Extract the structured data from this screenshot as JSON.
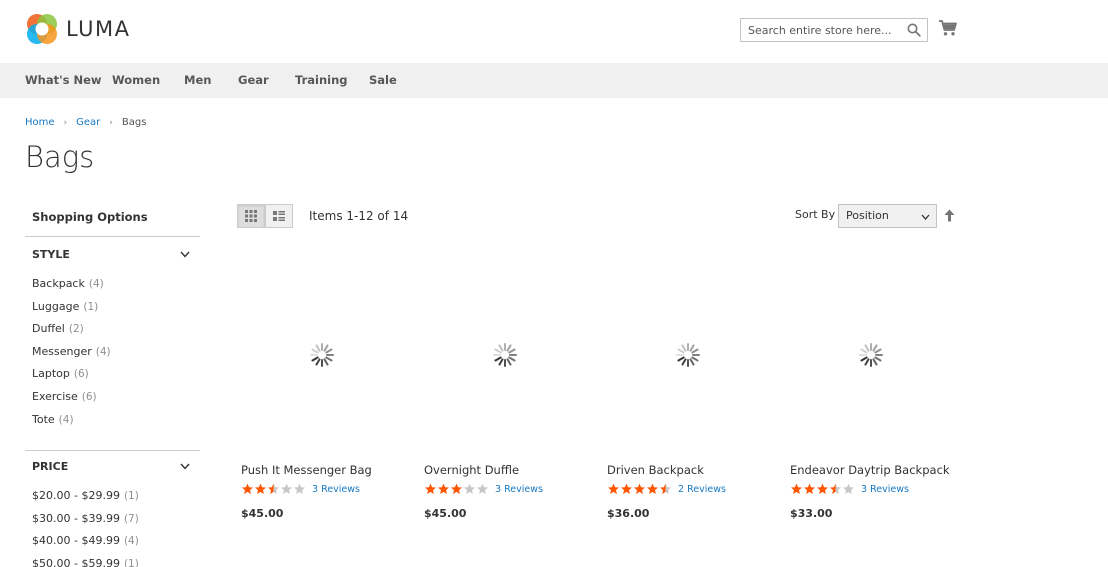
{
  "header": {
    "brand": "LUMA",
    "search_placeholder": "Search entire store here..."
  },
  "nav": [
    "What's New",
    "Women",
    "Men",
    "Gear",
    "Training",
    "Sale"
  ],
  "breadcrumbs": {
    "home": "Home",
    "gear": "Gear",
    "current": "Bags"
  },
  "page_title": "Bags",
  "sidebar": {
    "title": "Shopping Options",
    "filters": [
      {
        "name": "STYLE",
        "options": [
          {
            "label": "Backpack",
            "count": "(4)"
          },
          {
            "label": "Luggage",
            "count": "(1)"
          },
          {
            "label": "Duffel",
            "count": "(2)"
          },
          {
            "label": "Messenger",
            "count": "(4)"
          },
          {
            "label": "Laptop",
            "count": "(6)"
          },
          {
            "label": "Exercise",
            "count": "(6)"
          },
          {
            "label": "Tote",
            "count": "(4)"
          }
        ]
      },
      {
        "name": "PRICE",
        "options": [
          {
            "label": "$20.00 - $29.99",
            "count": "(1)"
          },
          {
            "label": "$30.00 - $39.99",
            "count": "(7)"
          },
          {
            "label": "$40.00 - $49.99",
            "count": "(4)"
          },
          {
            "label": "$50.00 - $59.99",
            "count": "(1)"
          }
        ]
      }
    ]
  },
  "toolbar": {
    "amount": "Items 1-12 of 14",
    "sort_label": "Sort By",
    "sort_value": "Position"
  },
  "products": [
    {
      "name": "Push It Messenger Bag",
      "rating": 2.5,
      "reviews": "3 Reviews",
      "price": "$45.00"
    },
    {
      "name": "Overnight Duffle",
      "rating": 3,
      "reviews": "3 Reviews",
      "price": "$45.00"
    },
    {
      "name": "Driven Backpack",
      "rating": 4.5,
      "reviews": "2 Reviews",
      "price": "$36.00"
    },
    {
      "name": "Endeavor Daytrip Backpack",
      "rating": 3.5,
      "reviews": "3 Reviews",
      "price": "$33.00"
    }
  ],
  "colors": {
    "star": "#ff5501",
    "star_empty": "#c7c7c7",
    "link": "#1979c3",
    "nav_bg": "#f0f0f0"
  },
  "icons": [
    "luma-logo-icon",
    "search-icon",
    "cart-icon",
    "chevron-down-icon",
    "grid-view-icon",
    "list-view-icon",
    "sort-arrow-up-icon",
    "loading-spinner-icon",
    "star-icon"
  ]
}
